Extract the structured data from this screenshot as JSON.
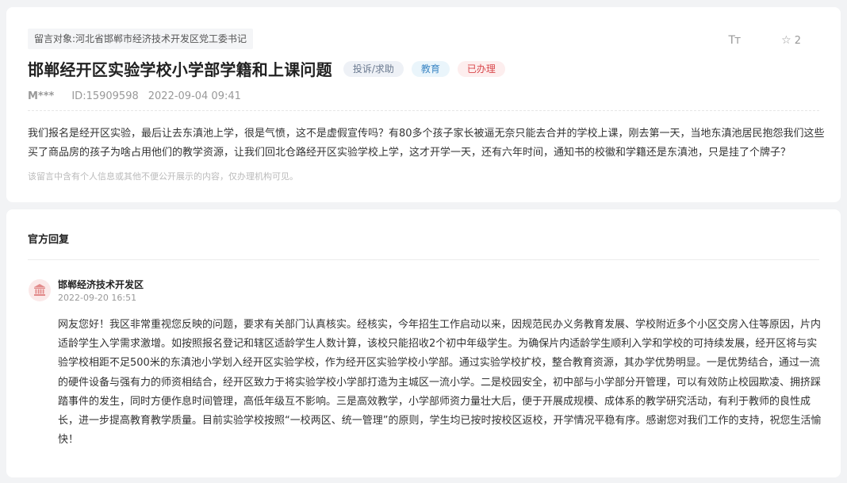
{
  "message": {
    "target_label": "留言对象:",
    "target_value": "河北省邯郸市经济技术开发区党工委书记",
    "font_icon": "Tт",
    "star_count": "2",
    "title": "邯郸经开区实验学校小学部学籍和上课问题",
    "badges": {
      "type": "投诉/求助",
      "category": "教育",
      "status": "已办理"
    },
    "author": "M***",
    "id": "ID:15909598",
    "datetime": "2022-09-04 09:41",
    "content": "我们报名是经开区实验，最后让去东滇池上学，很是气愤，这不是虚假宣传吗？有80多个孩子家长被逼无奈只能去合并的学校上课，刚去第一天，当地东滇池居民抱怨我们这些买了商品房的孩子为啥占用他们的教学资源，让我们回北仓路经开区实验学校上学，这才开学一天，还有六年时间，通知书的校徽和学籍还是东滇池，只是挂了个牌子？",
    "privacy_note": "该留言中含有个人信息或其他不便公开展示的内容，仅办理机构可见。"
  },
  "reply": {
    "header": "官方回复",
    "org_name": "邯郸经济技术开发区",
    "datetime": "2022-09-20 16:51",
    "content": "网友您好！我区非常重视您反映的问题，要求有关部门认真核实。经核实，今年招生工作启动以来，因规范民办义务教育发展、学校附近多个小区交房入住等原因，片内适龄学生入学需求激增。如按照报名登记和辖区适龄学生人数计算，该校只能招收2个初中年级学生。为确保片内适龄学生顺利入学和学校的可持续发展，经开区将与实验学校相距不足500米的东滇池小学划入经开区实验学校，作为经开区实验学校小学部。通过实验学校扩校，整合教育资源，其办学优势明显。一是优势结合，通过一流的硬件设备与强有力的师资相结合，经开区致力于将实验学校小学部打造为主城区一流小学。二是校园安全，初中部与小学部分开管理，可以有效防止校园欺凌、拥挤踩踏事件的发生，同时方便作息时间管理，高低年级互不影响。三是高效教学，小学部师资力量壮大后，便于开展成规模、成体系的教学研究活动，有利于教师的良性成长，进一步提高教育教学质量。目前实验学校按照“一校两区、统一管理”的原则，学生均已按时按校区返校，开学情况平稳有序。感谢您对我们工作的支持，祝您生活愉快！"
  },
  "colors": {
    "status_red": "#d9474b",
    "category_blue": "#3b86c4",
    "type_gray": "#6b7a90",
    "page_bg": "#f2f3f5"
  },
  "icons": [
    "font-size-icon",
    "star-icon",
    "government-building-icon"
  ]
}
